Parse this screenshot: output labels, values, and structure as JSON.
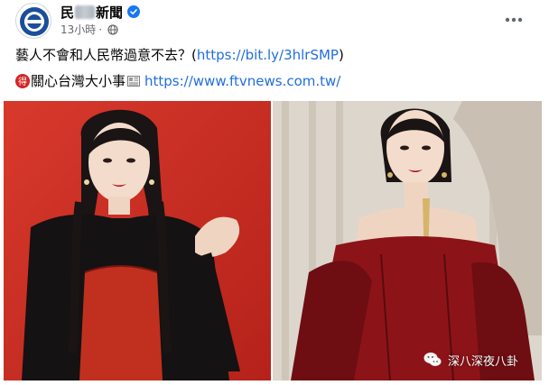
{
  "post": {
    "page_name_start": "民",
    "page_name_end": "新聞",
    "timestamp": "13小時",
    "separator": "·",
    "message": "藝人不會和人民幣過意不去？",
    "message_link": "https://bit.ly/3hlrSMP",
    "badge_char": "得",
    "tagline": "關心台灣大小事",
    "website_link": "https://www.ftvnews.com.tw/"
  },
  "watermark": {
    "text": "深八深夜八卦"
  },
  "colors": {
    "link": "#216fdb",
    "verified": "#1877f2",
    "meta": "#65676b",
    "left_bg": "#c42a20",
    "right_bg": "#ddd6cc",
    "dress_red": "#8c1418"
  },
  "icons": {
    "avatar": "ftv-logo",
    "verified": "verified-badge-icon",
    "privacy": "globe-icon",
    "more": "more-options-icon",
    "badge": "de-character-icon",
    "news": "newspaper-icon",
    "watermark": "wechat-icon"
  }
}
